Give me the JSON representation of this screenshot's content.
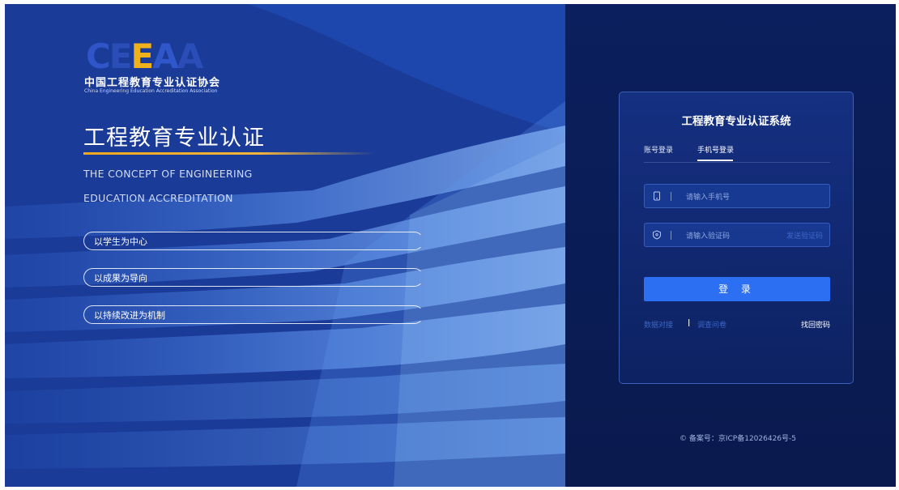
{
  "logo": {
    "mark": "CEEAA",
    "cn": "中国工程教育专业认证协会",
    "en": "China Engineering Education Accreditation Association"
  },
  "hero": {
    "title": "工程教育专业认证",
    "subtitle_line1": "THE CONCEPT OF ENGINEERING",
    "subtitle_line2": "EDUCATION ACCREDITATION",
    "principles": [
      "以学生为中心",
      "以成果为导向",
      "以持续改进为机制"
    ]
  },
  "login": {
    "title": "工程教育专业认证系统",
    "tabs": [
      "账号登录",
      "手机号登录"
    ],
    "active_tab": "手机号登录",
    "phone_placeholder": "请输入手机号",
    "code_placeholder": "请输入验证码",
    "send_code": "发送验证码",
    "submit": "登 录",
    "link_data": "数据对接",
    "link_sep": "|",
    "link_survey": "调查问卷",
    "link_forgot": "找回密码"
  },
  "footer": {
    "icp": "© 备案号：京ICP备12026426号-5"
  },
  "colors": {
    "accent": "#2c6ff2",
    "gold": "#f0a81e",
    "panel_bg": "#0a1a4e"
  }
}
